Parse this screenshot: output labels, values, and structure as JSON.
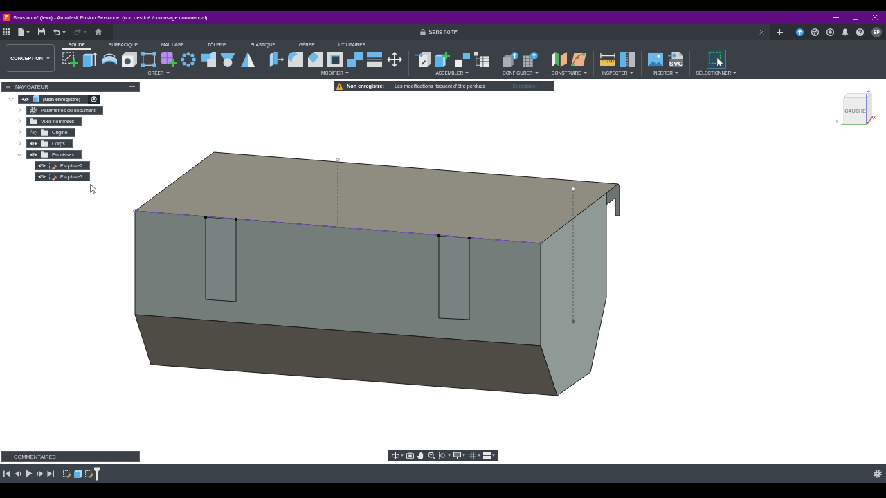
{
  "window": {
    "title": "Sans nom* (lexx) - Autodesk Fusion Personnel (non destiné à un usage commercial)"
  },
  "tab_bar": {
    "quick_access": [
      {
        "kind": "apps",
        "disabled": false
      },
      {
        "kind": "file",
        "disabled": false
      },
      {
        "kind": "save",
        "disabled": false
      },
      {
        "kind": "undo",
        "disabled": false
      },
      {
        "kind": "redo",
        "disabled": true
      },
      {
        "kind": "home",
        "disabled": false
      }
    ],
    "document_tab": {
      "title": "Sans nom*"
    },
    "user": {
      "initials": "EP"
    }
  },
  "toolbar": {
    "workspace": "CONCEPTION",
    "tabs": [
      {
        "label": "SOLIDE",
        "selected": true
      },
      {
        "label": "SURFACIQUE",
        "selected": false
      },
      {
        "label": "MAILLAGE",
        "selected": false
      },
      {
        "label": "TÔLERIE",
        "selected": false
      },
      {
        "label": "PLASTIQUE",
        "selected": false
      },
      {
        "label": "GÉRER",
        "selected": false
      },
      {
        "label": "UTILITAIRES",
        "selected": false
      }
    ],
    "groups": [
      {
        "label": "CRÉER",
        "active": false
      },
      {
        "label": "MODIFIER",
        "active": false
      },
      {
        "label": "ASSEMBLER",
        "active": false
      },
      {
        "label": "CONFIGURER",
        "active": false
      },
      {
        "label": "CONSTRUIRE",
        "active": false
      },
      {
        "label": "INSPECTER",
        "active": false
      },
      {
        "label": "INSÉRER",
        "active": false,
        "badge": "SVG"
      },
      {
        "label": "SÉLECTIONNER",
        "active": true
      }
    ]
  },
  "warning": {
    "title": "Non enregistré:",
    "message": "Les modifications risquent d'être perdues",
    "action": "Enregistrer"
  },
  "navigator": {
    "title": "NAVIGATEUR",
    "tree": [
      {
        "label": "(Non enregistré)",
        "kind": "component",
        "expanded": true,
        "visible": true,
        "active": true,
        "children": [
          {
            "label": "Paramètres du document",
            "kind": "settings",
            "expanded": false
          },
          {
            "label": "Vues nommées",
            "kind": "folder",
            "expanded": false
          },
          {
            "label": "Origine",
            "kind": "folder",
            "expanded": false,
            "visible": false
          },
          {
            "label": "Corps",
            "kind": "folder",
            "expanded": false,
            "visible": true
          },
          {
            "label": "Esquisses",
            "kind": "folder",
            "expanded": true,
            "visible": true,
            "children": [
              {
                "label": "Esquisse2",
                "kind": "sketch",
                "visible": true
              },
              {
                "label": "Esquisse3",
                "kind": "sketch",
                "visible": true
              }
            ]
          }
        ]
      }
    ]
  },
  "view_cube": {
    "face": "GAUCHE",
    "axes": [
      {
        "label": "Z"
      },
      {
        "label": "X"
      },
      {
        "label": "Y"
      }
    ]
  },
  "comments": {
    "title": "COMMENTAIRES"
  },
  "timeline": {
    "features": [
      {
        "kind": "sketch"
      },
      {
        "kind": "extrude"
      },
      {
        "kind": "sketch"
      }
    ]
  }
}
